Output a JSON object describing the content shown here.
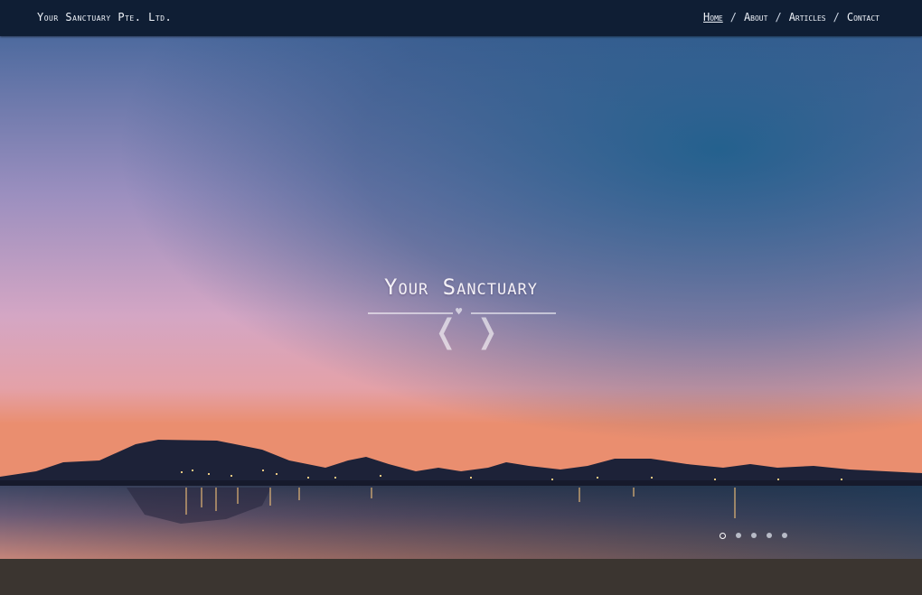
{
  "header": {
    "brand": "Your Sanctuary Pte. Ltd.",
    "nav": [
      {
        "label": "Home",
        "active": true
      },
      {
        "label": "About",
        "active": false
      },
      {
        "label": "Articles",
        "active": false
      },
      {
        "label": "Contact",
        "active": false
      }
    ],
    "separator": "/"
  },
  "hero": {
    "title": "Your Sanctuary",
    "divider_icon": "heart-icon",
    "prev_glyph": "❬",
    "next_glyph": "❭",
    "slides_total": 5,
    "slides_active_index": 0
  },
  "colors": {
    "header_bg": "#0f1e34",
    "sky_top": "#2f4d7e",
    "sky_pink": "#d7a9c7",
    "horizon": "#e88b6d",
    "footer_bg": "#3b3530"
  }
}
